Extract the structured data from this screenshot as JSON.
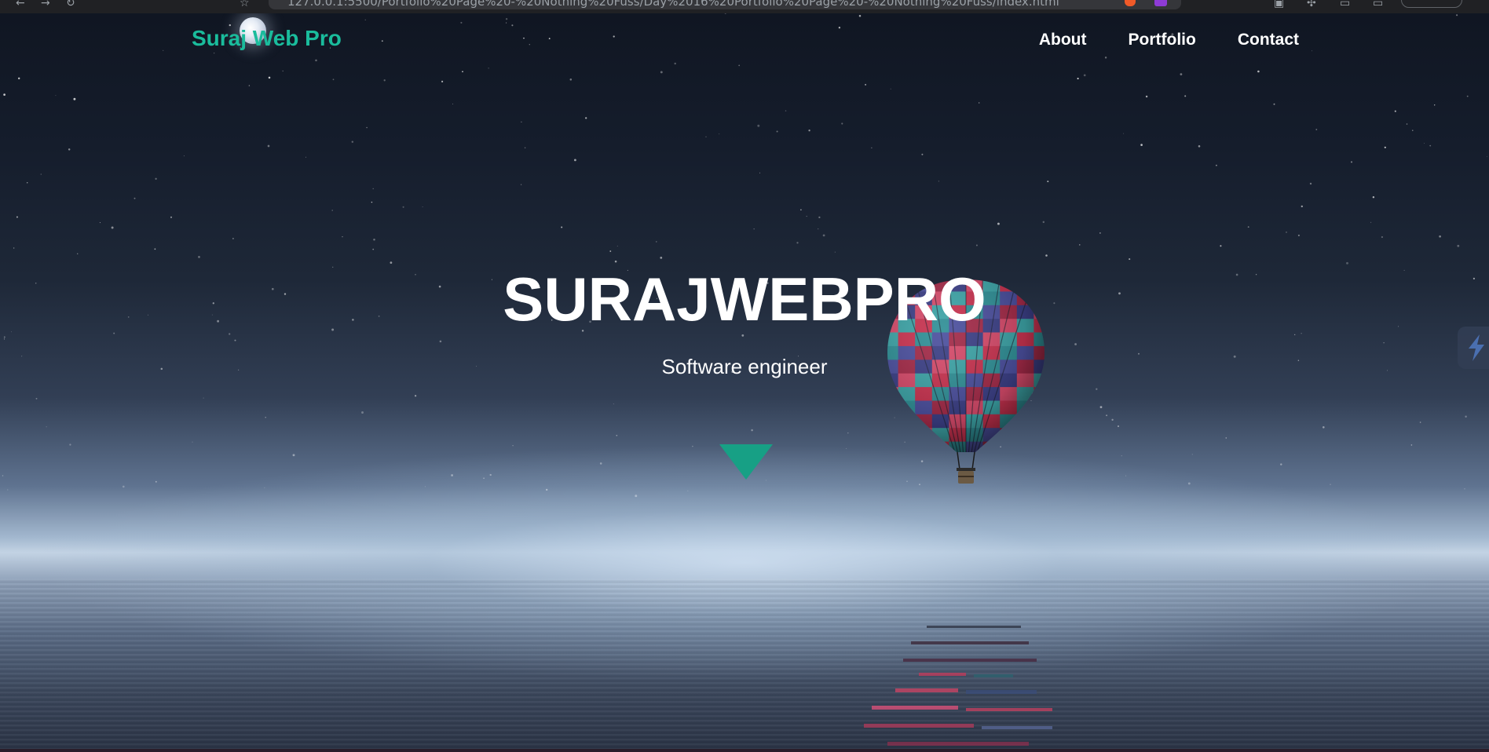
{
  "browser": {
    "url": "127.0.0.1:5500/Portfolio%20Page%20-%20Nothing%20Fuss/Day%2016%20Portfolio%20Page%20-%20Nothing%20Fuss/index.html"
  },
  "navbar": {
    "brand": "Suraj Web Pro",
    "links": [
      {
        "label": "About"
      },
      {
        "label": "Portfolio"
      },
      {
        "label": "Contact"
      }
    ]
  },
  "hero": {
    "title": "SURAJWEBPRO",
    "subtitle": "Software engineer"
  },
  "icons": {
    "scroll": "caret-down-icon",
    "moon": "moon-icon",
    "balloon": "hot-air-balloon",
    "widget": "lightning-bolt-icon"
  },
  "colors": {
    "accent": "#1abc9c",
    "arrow": "#17a085",
    "nav_text": "#ffffff"
  }
}
